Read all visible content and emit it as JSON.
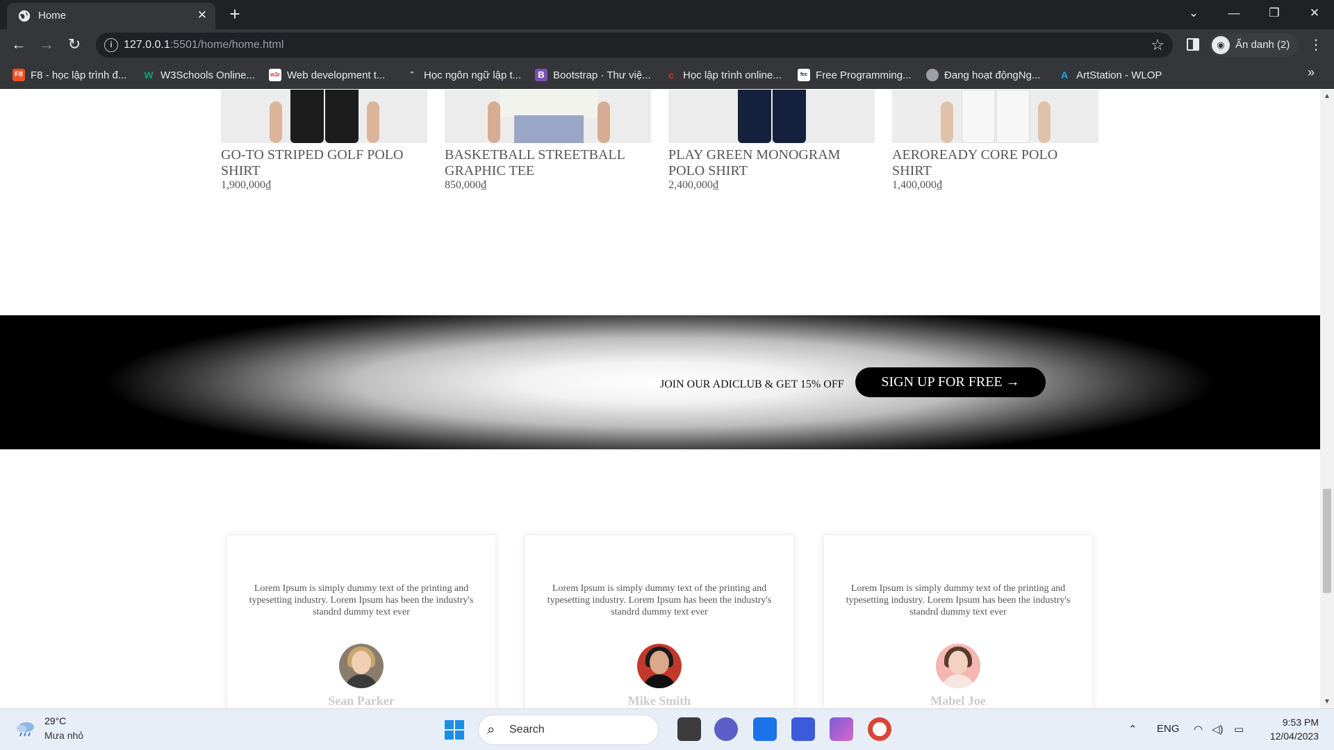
{
  "browser": {
    "tab_title": "Home",
    "url_host": "127.0.0.1",
    "url_rest": ":5501/home/home.html",
    "profile_label": "Ẩn danh (2)",
    "bookmarks": [
      {
        "label": "F8 - học lập trình đ...",
        "icon": "F8",
        "color": "#f05123"
      },
      {
        "label": "W3Schools Online...",
        "icon": "W",
        "color": "#04aa6d"
      },
      {
        "label": "Web development t...",
        "icon": "w3r",
        "color": "#ffffff"
      },
      {
        "label": "Học ngôn ngữ lập t...",
        "icon": "\"",
        "color": "#35363a"
      },
      {
        "label": "Bootstrap · Thư việ...",
        "icon": "B",
        "color": "#7952b3"
      },
      {
        "label": "Học lập trình online...",
        "icon": "c",
        "color": "#d32f2f"
      },
      {
        "label": "Free Programming...",
        "icon": "fcc",
        "color": "#0a0a23"
      },
      {
        "label": "Đang hoạt độngNg...",
        "icon": "globe",
        "color": "#9aa0a6"
      },
      {
        "label": "ArtStation - WLOP",
        "icon": "A",
        "color": "#13aff0"
      }
    ]
  },
  "products": [
    {
      "name": "GO-TO STRIPED GOLF POLO SHIRT",
      "price": "1,900,000₫",
      "pants_color": "#1c1c1c"
    },
    {
      "name": "BASKETBALL STREETBALL GRAPHIC TEE",
      "price": "850,000₫",
      "pants_color": "#9aa6c8"
    },
    {
      "name": "PLAY GREEN MONOGRAM POLO SHIRT",
      "price": "2,400,000₫",
      "pants_color": "#14213d"
    },
    {
      "name": "AEROREADY CORE POLO SHIRT",
      "price": "1,400,000₫",
      "pants_color": "#f4f4f4"
    }
  ],
  "banner": {
    "promo_text": "JOIN OUR ADICLUB & GET 15% OFF",
    "cta_label": "SIGN UP FOR FREE →"
  },
  "testimonials": [
    {
      "quote": "Lorem Ipsum is simply dummy text of the printing and typesetting industry. Lorem Ipsum has been the industry's standrd dummy text ever",
      "author": "Sean Parker"
    },
    {
      "quote": "Lorem Ipsum is simply dummy text of the printing and typesetting industry. Lorem Ipsum has been the industry's standrd dummy text ever",
      "author": "Mike Smith"
    },
    {
      "quote": "Lorem Ipsum is simply dummy text of the printing and typesetting industry. Lorem Ipsum has been the industry's standrd dummy text ever",
      "author": "Mabel Joe"
    }
  ],
  "taskbar": {
    "weather_temp": "29°C",
    "weather_desc": "Mưa nhỏ",
    "search_label": "Search",
    "language": "ENG",
    "time": "9:53 PM",
    "date": "12/04/2023"
  }
}
